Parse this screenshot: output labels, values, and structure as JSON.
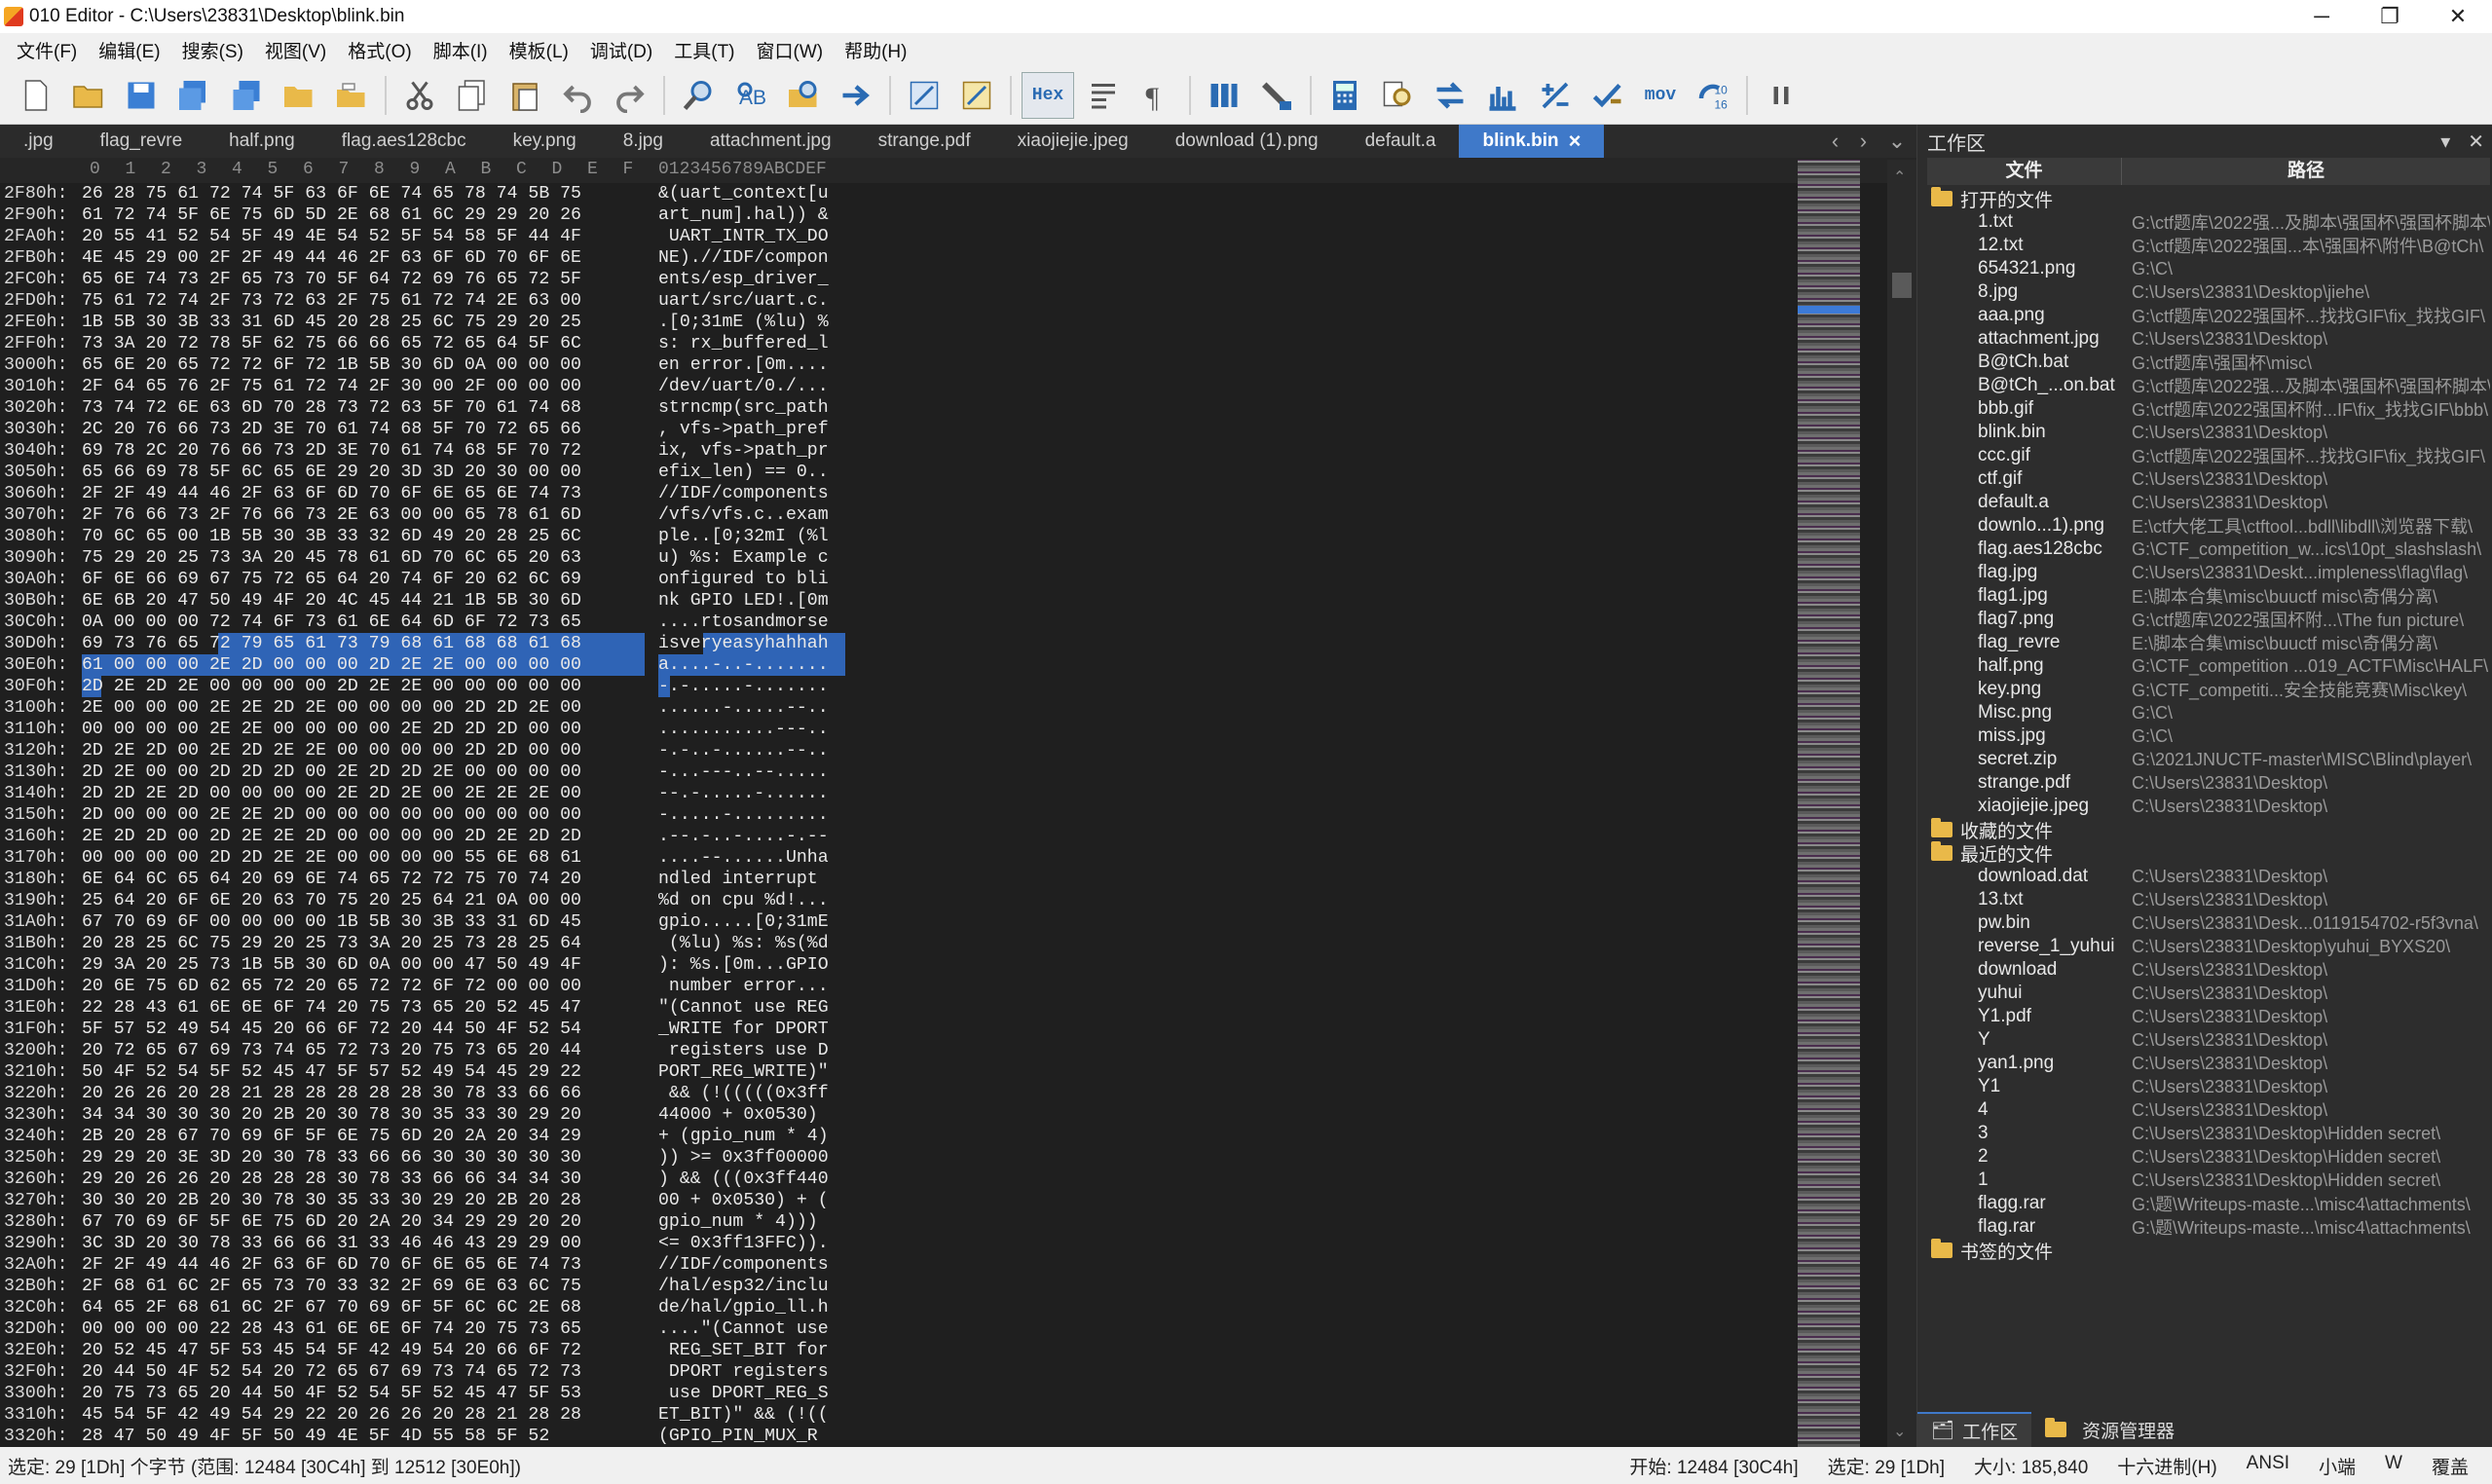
{
  "window": {
    "title": "010 Editor - C:\\Users\\23831\\Desktop\\blink.bin",
    "minimize": "─",
    "maximize": "❐",
    "close": "✕"
  },
  "menu": [
    "文件(F)",
    "编辑(E)",
    "搜索(S)",
    "视图(V)",
    "格式(O)",
    "脚本(I)",
    "模板(L)",
    "调试(D)",
    "工具(T)",
    "窗口(W)",
    "帮助(H)"
  ],
  "toolbar": {
    "hex_label": "Hex",
    "mov_label": "mov",
    "counter_label": "10\n16"
  },
  "tabs": [
    ".jpg",
    "flag_revre",
    "half.png",
    "flag.aes128cbc",
    "key.png",
    "8.jpg",
    "attachment.jpg",
    "strange.pdf",
    "xiaojiejie.jpeg",
    "download (1).png",
    "default.a",
    "blink.bin"
  ],
  "tabs_active": 11,
  "hex": {
    "header_cols": [
      "0",
      "1",
      "2",
      "3",
      "4",
      "5",
      "6",
      "7",
      "8",
      "9",
      "A",
      "B",
      "C",
      "D",
      "E",
      "F"
    ],
    "header_ascii": "0123456789ABCDEF",
    "rows": [
      {
        "addr": "2F80h:",
        "bytes": "26 28 75 61 72 74 5F 63 6F 6E 74 65 78 74 5B 75",
        "ascii": "&(uart_context[u"
      },
      {
        "addr": "2F90h:",
        "bytes": "61 72 74 5F 6E 75 6D 5D 2E 68 61 6C 29 29 20 26",
        "ascii": "art_num].hal)) &"
      },
      {
        "addr": "2FA0h:",
        "bytes": "20 55 41 52 54 5F 49 4E 54 52 5F 54 58 5F 44 4F",
        "ascii": " UART_INTR_TX_DO"
      },
      {
        "addr": "2FB0h:",
        "bytes": "4E 45 29 00 2F 2F 49 44 46 2F 63 6F 6D 70 6F 6E",
        "ascii": "NE).//IDF/compon"
      },
      {
        "addr": "2FC0h:",
        "bytes": "65 6E 74 73 2F 65 73 70 5F 64 72 69 76 65 72 5F",
        "ascii": "ents/esp_driver_"
      },
      {
        "addr": "2FD0h:",
        "bytes": "75 61 72 74 2F 73 72 63 2F 75 61 72 74 2E 63 00",
        "ascii": "uart/src/uart.c."
      },
      {
        "addr": "2FE0h:",
        "bytes": "1B 5B 30 3B 33 31 6D 45 20 28 25 6C 75 29 20 25",
        "ascii": ".[0;31mE (%lu) %"
      },
      {
        "addr": "2FF0h:",
        "bytes": "73 3A 20 72 78 5F 62 75 66 66 65 72 65 64 5F 6C",
        "ascii": "s: rx_buffered_l"
      },
      {
        "addr": "3000h:",
        "bytes": "65 6E 20 65 72 72 6F 72 1B 5B 30 6D 0A 00 00 00",
        "ascii": "en error.[0m...."
      },
      {
        "addr": "3010h:",
        "bytes": "2F 64 65 76 2F 75 61 72 74 2F 30 00 2F 00 00 00",
        "ascii": "/dev/uart/0./..."
      },
      {
        "addr": "3020h:",
        "bytes": "73 74 72 6E 63 6D 70 28 73 72 63 5F 70 61 74 68",
        "ascii": "strncmp(src_path"
      },
      {
        "addr": "3030h:",
        "bytes": "2C 20 76 66 73 2D 3E 70 61 74 68 5F 70 72 65 66",
        "ascii": ", vfs->path_pref"
      },
      {
        "addr": "3040h:",
        "bytes": "69 78 2C 20 76 66 73 2D 3E 70 61 74 68 5F 70 72",
        "ascii": "ix, vfs->path_pr"
      },
      {
        "addr": "3050h:",
        "bytes": "65 66 69 78 5F 6C 65 6E 29 20 3D 3D 20 30 00 00",
        "ascii": "efix_len) == 0.."
      },
      {
        "addr": "3060h:",
        "bytes": "2F 2F 49 44 46 2F 63 6F 6D 70 6F 6E 65 6E 74 73",
        "ascii": "//IDF/components"
      },
      {
        "addr": "3070h:",
        "bytes": "2F 76 66 73 2F 76 66 73 2E 63 00 00 65 78 61 6D",
        "ascii": "/vfs/vfs.c..exam"
      },
      {
        "addr": "3080h:",
        "bytes": "70 6C 65 00 1B 5B 30 3B 33 32 6D 49 20 28 25 6C",
        "ascii": "ple..[0;32mI (%l"
      },
      {
        "addr": "3090h:",
        "bytes": "75 29 20 25 73 3A 20 45 78 61 6D 70 6C 65 20 63",
        "ascii": "u) %s: Example c"
      },
      {
        "addr": "30A0h:",
        "bytes": "6F 6E 66 69 67 75 72 65 64 20 74 6F 20 62 6C 69",
        "ascii": "onfigured to bli"
      },
      {
        "addr": "30B0h:",
        "bytes": "6E 6B 20 47 50 49 4F 20 4C 45 44 21 1B 5B 30 6D",
        "ascii": "nk GPIO LED!.[0m"
      },
      {
        "addr": "30C0h:",
        "bytes": "0A 00 00 00 72 74 6F 73 61 6E 64 6D 6F 72 73 65",
        "ascii": "....rtosandmorse"
      },
      {
        "addr": "30D0h:",
        "bytes": "69 73 76 65 72 79 65 61 73 79 68 61 68 68 61 68",
        "ascii": "isveryeasyhahhah"
      },
      {
        "addr": "30E0h:",
        "bytes": "61 00 00 00 2E 2D 00 00 00 2D 2E 2E 00 00 00 00",
        "ascii": "a....-..-......."
      },
      {
        "addr": "30F0h:",
        "bytes": "2D 2E 2D 2E 00 00 00 00 2D 2E 2E 00 00 00 00 00",
        "ascii": "-.-.....-......."
      },
      {
        "addr": "3100h:",
        "bytes": "2E 00 00 00 2E 2E 2D 2E 00 00 00 00 2D 2D 2E 00",
        "ascii": "......-.....--.."
      },
      {
        "addr": "3110h:",
        "bytes": "00 00 00 00 2E 2E 00 00 00 00 2E 2D 2D 2D 00 00",
        "ascii": "...........---.."
      },
      {
        "addr": "3120h:",
        "bytes": "2D 2E 2D 00 2E 2D 2E 2E 00 00 00 00 2D 2D 00 00",
        "ascii": "-.-..-......--.."
      },
      {
        "addr": "3130h:",
        "bytes": "2D 2E 00 00 2D 2D 2D 00 2E 2D 2D 2E 00 00 00 00",
        "ascii": "-...---..--....."
      },
      {
        "addr": "3140h:",
        "bytes": "2D 2D 2E 2D 00 00 00 00 2E 2D 2E 00 2E 2E 2E 00",
        "ascii": "--.-.....-......"
      },
      {
        "addr": "3150h:",
        "bytes": "2D 00 00 00 2E 2E 2D 00 00 00 00 00 00 00 00 00",
        "ascii": "-.....-........."
      },
      {
        "addr": "3160h:",
        "bytes": "2E 2D 2D 00 2D 2E 2E 2D 00 00 00 00 2D 2E 2D 2D",
        "ascii": ".--.-..-....-.--"
      },
      {
        "addr": "3170h:",
        "bytes": "00 00 00 00 2D 2D 2E 2E 00 00 00 00 55 6E 68 61",
        "ascii": "....--......Unha"
      },
      {
        "addr": "3180h:",
        "bytes": "6E 64 6C 65 64 20 69 6E 74 65 72 72 75 70 74 20",
        "ascii": "ndled interrupt "
      },
      {
        "addr": "3190h:",
        "bytes": "25 64 20 6F 6E 20 63 70 75 20 25 64 21 0A 00 00",
        "ascii": "%d on cpu %d!..."
      },
      {
        "addr": "31A0h:",
        "bytes": "67 70 69 6F 00 00 00 00 1B 5B 30 3B 33 31 6D 45",
        "ascii": "gpio.....[0;31mE"
      },
      {
        "addr": "31B0h:",
        "bytes": "20 28 25 6C 75 29 20 25 73 3A 20 25 73 28 25 64",
        "ascii": " (%lu) %s: %s(%d"
      },
      {
        "addr": "31C0h:",
        "bytes": "29 3A 20 25 73 1B 5B 30 6D 0A 00 00 47 50 49 4F",
        "ascii": "): %s.[0m...GPIO"
      },
      {
        "addr": "31D0h:",
        "bytes": "20 6E 75 6D 62 65 72 20 65 72 72 6F 72 00 00 00",
        "ascii": " number error..."
      },
      {
        "addr": "31E0h:",
        "bytes": "22 28 43 61 6E 6E 6F 74 20 75 73 65 20 52 45 47",
        "ascii": "\"(Cannot use REG"
      },
      {
        "addr": "31F0h:",
        "bytes": "5F 57 52 49 54 45 20 66 6F 72 20 44 50 4F 52 54",
        "ascii": "_WRITE for DPORT"
      },
      {
        "addr": "3200h:",
        "bytes": "20 72 65 67 69 73 74 65 72 73 20 75 73 65 20 44",
        "ascii": " registers use D"
      },
      {
        "addr": "3210h:",
        "bytes": "50 4F 52 54 5F 52 45 47 5F 57 52 49 54 45 29 22",
        "ascii": "PORT_REG_WRITE)\""
      },
      {
        "addr": "3220h:",
        "bytes": "20 26 26 20 28 21 28 28 28 28 28 30 78 33 66 66",
        "ascii": " && (!(((((0x3ff"
      },
      {
        "addr": "3230h:",
        "bytes": "34 34 30 30 30 20 2B 20 30 78 30 35 33 30 29 20",
        "ascii": "44000 + 0x0530) "
      },
      {
        "addr": "3240h:",
        "bytes": "2B 20 28 67 70 69 6F 5F 6E 75 6D 20 2A 20 34 29",
        "ascii": "+ (gpio_num * 4)"
      },
      {
        "addr": "3250h:",
        "bytes": "29 29 20 3E 3D 20 30 78 33 66 66 30 30 30 30 30",
        "ascii": ")) >= 0x3ff00000"
      },
      {
        "addr": "3260h:",
        "bytes": "29 20 26 26 20 28 28 28 30 78 33 66 66 34 34 30",
        "ascii": ") && (((0x3ff440"
      },
      {
        "addr": "3270h:",
        "bytes": "30 30 20 2B 20 30 78 30 35 33 30 29 20 2B 20 28",
        "ascii": "00 + 0x0530) + ("
      },
      {
        "addr": "3280h:",
        "bytes": "67 70 69 6F 5F 6E 75 6D 20 2A 20 34 29 29 20 20",
        "ascii": "gpio_num * 4))) "
      },
      {
        "addr": "3290h:",
        "bytes": "3C 3D 20 30 78 33 66 66 31 33 46 46 43 29 29 00",
        "ascii": "<= 0x3ff13FFC))."
      },
      {
        "addr": "32A0h:",
        "bytes": "2F 2F 49 44 46 2F 63 6F 6D 70 6F 6E 65 6E 74 73",
        "ascii": "//IDF/components"
      },
      {
        "addr": "32B0h:",
        "bytes": "2F 68 61 6C 2F 65 73 70 33 32 2F 69 6E 63 6C 75",
        "ascii": "/hal/esp32/inclu"
      },
      {
        "addr": "32C0h:",
        "bytes": "64 65 2F 68 61 6C 2F 67 70 69 6F 5F 6C 6C 2E 68",
        "ascii": "de/hal/gpio_ll.h"
      },
      {
        "addr": "32D0h:",
        "bytes": "00 00 00 00 22 28 43 61 6E 6E 6F 74 20 75 73 65",
        "ascii": "....\"(Cannot use"
      },
      {
        "addr": "32E0h:",
        "bytes": "20 52 45 47 5F 53 45 54 5F 42 49 54 20 66 6F 72",
        "ascii": " REG_SET_BIT for"
      },
      {
        "addr": "32F0h:",
        "bytes": "20 44 50 4F 52 54 20 72 65 67 69 73 74 65 72 73",
        "ascii": " DPORT registers"
      },
      {
        "addr": "3300h:",
        "bytes": "20 75 73 65 20 44 50 4F 52 54 5F 52 45 47 5F 53",
        "ascii": " use DPORT_REG_S"
      },
      {
        "addr": "3310h:",
        "bytes": "45 54 5F 42 49 54 29 22 20 26 26 20 28 21 28 28",
        "ascii": "ET_BIT)\" && (!(("
      },
      {
        "addr": "3320h:",
        "bytes": "28 47 50 49 4F 5F 50 49 4E 5F 4D 55 58 5F 52",
        "ascii": "(GPIO_PIN_MUX_R"
      }
    ]
  },
  "workspace": {
    "title": "工作区",
    "col_file": "文件",
    "col_path": "路径",
    "group_open": "打开的文件",
    "group_fav": "收藏的文件",
    "group_recent": "最近的文件",
    "group_bookmark": "书签的文件",
    "open_files": [
      {
        "name": "1.txt",
        "path": "G:\\ctf题库\\2022强...及脚本\\强国杯\\强国杯脚本\\"
      },
      {
        "name": "12.txt",
        "path": "G:\\ctf题库\\2022强国...本\\强国杯\\附件\\B@tCh\\"
      },
      {
        "name": "654321.png",
        "path": "G:\\C\\"
      },
      {
        "name": "8.jpg",
        "path": "C:\\Users\\23831\\Desktop\\jiehe\\"
      },
      {
        "name": "aaa.png",
        "path": "G:\\ctf题库\\2022强国杯...找找GIF\\fix_找找GIF\\"
      },
      {
        "name": "attachment.jpg",
        "path": "C:\\Users\\23831\\Desktop\\"
      },
      {
        "name": "B@tCh.bat",
        "path": "G:\\ctf题库\\强国杯\\misc\\"
      },
      {
        "name": "B@tCh_...on.bat",
        "path": "G:\\ctf题库\\2022强...及脚本\\强国杯\\强国杯脚本\\"
      },
      {
        "name": "bbb.gif",
        "path": "G:\\ctf题库\\2022强国杯附...IF\\fix_找找GIF\\bbb\\"
      },
      {
        "name": "blink.bin",
        "path": "C:\\Users\\23831\\Desktop\\"
      },
      {
        "name": "ccc.gif",
        "path": "G:\\ctf题库\\2022强国杯...找找GIF\\fix_找找GIF\\"
      },
      {
        "name": "ctf.gif",
        "path": "C:\\Users\\23831\\Desktop\\"
      },
      {
        "name": "default.a",
        "path": "C:\\Users\\23831\\Desktop\\"
      },
      {
        "name": "downlo...1).png",
        "path": "E:\\ctf大佬工具\\ctftool...bdll\\libdll\\浏览器下载\\"
      },
      {
        "name": "flag.aes128cbc",
        "path": "G:\\CTF_competition_w...ics\\10pt_slashslash\\"
      },
      {
        "name": "flag.jpg",
        "path": "C:\\Users\\23831\\Deskt...impleness\\flag\\flag\\"
      },
      {
        "name": "flag1.jpg",
        "path": "E:\\脚本合集\\misc\\buuctf misc\\奇偶分离\\"
      },
      {
        "name": "flag7.png",
        "path": "G:\\ctf题库\\2022强国杯附...\\The fun picture\\"
      },
      {
        "name": "flag_revre",
        "path": "E:\\脚本合集\\misc\\buuctf misc\\奇偶分离\\"
      },
      {
        "name": "half.png",
        "path": "G:\\CTF_competition ...019_ACTF\\Misc\\HALF\\"
      },
      {
        "name": "key.png",
        "path": "G:\\CTF_competiti...安全技能竞赛\\Misc\\key\\"
      },
      {
        "name": "Misc.png",
        "path": "G:\\C\\"
      },
      {
        "name": "miss.jpg",
        "path": "G:\\C\\"
      },
      {
        "name": "secret.zip",
        "path": "G:\\2021JNUCTF-master\\MISC\\Blind\\player\\"
      },
      {
        "name": "strange.pdf",
        "path": "C:\\Users\\23831\\Desktop\\"
      },
      {
        "name": "xiaojiejie.jpeg",
        "path": "C:\\Users\\23831\\Desktop\\"
      }
    ],
    "recent_files": [
      {
        "name": "download.dat",
        "path": "C:\\Users\\23831\\Desktop\\"
      },
      {
        "name": "13.txt",
        "path": "C:\\Users\\23831\\Desktop\\"
      },
      {
        "name": "pw.bin",
        "path": "C:\\Users\\23831\\Desk...0119154702-r5f3vna\\"
      },
      {
        "name": "reverse_1_yuhui",
        "path": "C:\\Users\\23831\\Desktop\\yuhui_BYXS20\\"
      },
      {
        "name": "download",
        "path": "C:\\Users\\23831\\Desktop\\"
      },
      {
        "name": "yuhui",
        "path": "C:\\Users\\23831\\Desktop\\"
      },
      {
        "name": "Y1.pdf",
        "path": "C:\\Users\\23831\\Desktop\\"
      },
      {
        "name": "Y",
        "path": "C:\\Users\\23831\\Desktop\\"
      },
      {
        "name": "yan1.png",
        "path": "C:\\Users\\23831\\Desktop\\"
      },
      {
        "name": "Y1",
        "path": "C:\\Users\\23831\\Desktop\\"
      },
      {
        "name": "4",
        "path": "C:\\Users\\23831\\Desktop\\"
      },
      {
        "name": "3",
        "path": "C:\\Users\\23831\\Desktop\\Hidden secret\\"
      },
      {
        "name": "2",
        "path": "C:\\Users\\23831\\Desktop\\Hidden secret\\"
      },
      {
        "name": "1",
        "path": "C:\\Users\\23831\\Desktop\\Hidden secret\\"
      },
      {
        "name": "flagg.rar",
        "path": "G:\\题\\Writeups-maste...\\misc4\\attachments\\"
      },
      {
        "name": "flag.rar",
        "path": "G:\\题\\Writeups-maste...\\misc4\\attachments\\"
      }
    ],
    "bottom_tab_workspace": "工作区",
    "bottom_tab_explorer": "资源管理器"
  },
  "status": {
    "selection": "选定: 29 [1Dh] 个字节 (范围: 12484 [30C4h] 到 12512 [30E0h])",
    "start": "开始: 12484 [30C4h]",
    "sel": "选定: 29 [1Dh]",
    "size": "大小: 185,840",
    "mode": "十六进制(H)",
    "encoding": "ANSI",
    "endian": "小端",
    "w": "W",
    "overwrite": "覆盖"
  },
  "colors": {
    "selection": "#2f64b6",
    "active_tab": "#3f79c9",
    "editor_bg": "#1f1f1f"
  }
}
